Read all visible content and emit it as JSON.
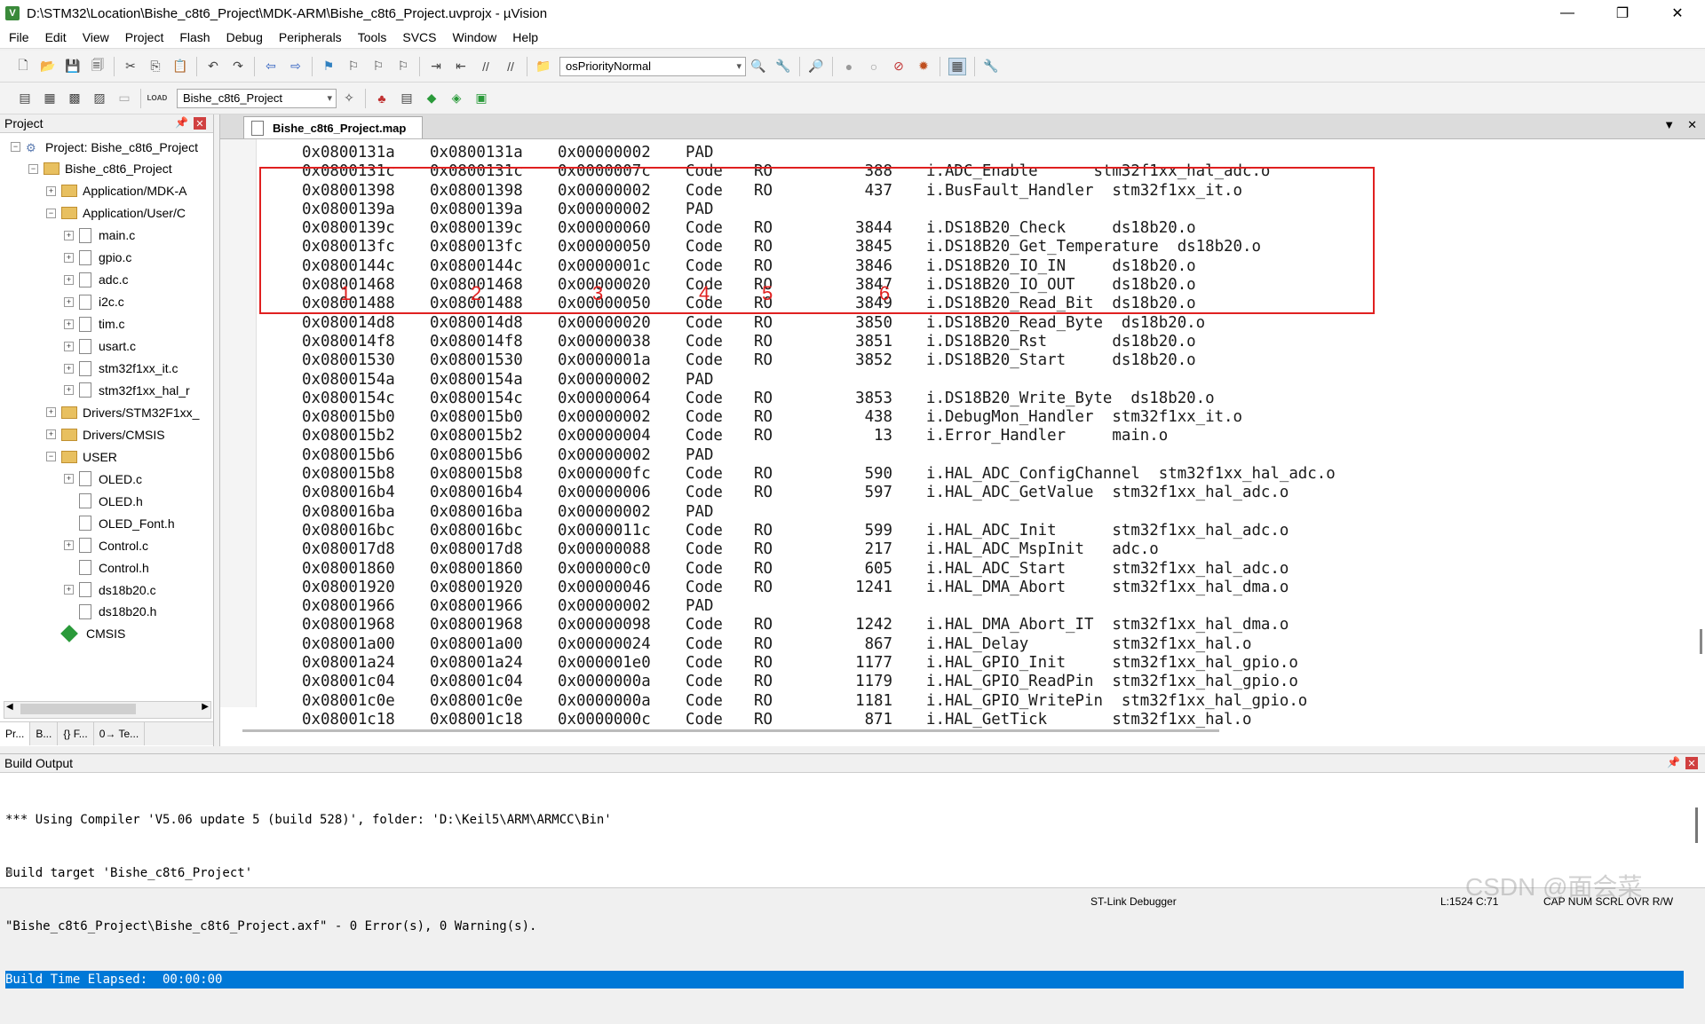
{
  "window": {
    "title": "D:\\STM32\\Location\\Bishe_c8t6_Project\\MDK-ARM\\Bishe_c8t6_Project.uvprojx - µVision",
    "icon_label": "V",
    "controls": [
      "—",
      "❐",
      "✕"
    ]
  },
  "menu": [
    "File",
    "Edit",
    "View",
    "Project",
    "Flash",
    "Debug",
    "Peripherals",
    "Tools",
    "SVCS",
    "Window",
    "Help"
  ],
  "toolbar": {
    "priority_combo": "osPriorityNormal",
    "target_combo": "Bishe_c8t6_Project",
    "load_label": "LOAD"
  },
  "project_panel": {
    "title": "Project",
    "tree": [
      {
        "label": "Project: Bishe_c8t6_Project",
        "level": 0,
        "kind": "project",
        "exp": "−"
      },
      {
        "label": "Bishe_c8t6_Project",
        "level": 1,
        "kind": "target",
        "exp": "−"
      },
      {
        "label": "Application/MDK-A",
        "level": 2,
        "kind": "folder",
        "exp": "+"
      },
      {
        "label": "Application/User/C",
        "level": 2,
        "kind": "folder",
        "exp": "−"
      },
      {
        "label": "main.c",
        "level": 3,
        "kind": "file",
        "exp": "+"
      },
      {
        "label": "gpio.c",
        "level": 3,
        "kind": "file",
        "exp": "+"
      },
      {
        "label": "adc.c",
        "level": 3,
        "kind": "file",
        "exp": "+"
      },
      {
        "label": "i2c.c",
        "level": 3,
        "kind": "file",
        "exp": "+"
      },
      {
        "label": "tim.c",
        "level": 3,
        "kind": "file",
        "exp": "+"
      },
      {
        "label": "usart.c",
        "level": 3,
        "kind": "file",
        "exp": "+"
      },
      {
        "label": "stm32f1xx_it.c",
        "level": 3,
        "kind": "file",
        "exp": "+"
      },
      {
        "label": "stm32f1xx_hal_r",
        "level": 3,
        "kind": "file",
        "exp": "+"
      },
      {
        "label": "Drivers/STM32F1xx_",
        "level": 2,
        "kind": "folder",
        "exp": "+"
      },
      {
        "label": "Drivers/CMSIS",
        "level": 2,
        "kind": "folder",
        "exp": "+"
      },
      {
        "label": "USER",
        "level": 2,
        "kind": "folder",
        "exp": "−"
      },
      {
        "label": "OLED.c",
        "level": 3,
        "kind": "file",
        "exp": "+"
      },
      {
        "label": "OLED.h",
        "level": 3,
        "kind": "file",
        "exp": ""
      },
      {
        "label": "OLED_Font.h",
        "level": 3,
        "kind": "file",
        "exp": ""
      },
      {
        "label": "Control.c",
        "level": 3,
        "kind": "file",
        "exp": "+"
      },
      {
        "label": "Control.h",
        "level": 3,
        "kind": "file",
        "exp": ""
      },
      {
        "label": "ds18b20.c",
        "level": 3,
        "kind": "file",
        "exp": "+"
      },
      {
        "label": "ds18b20.h",
        "level": 3,
        "kind": "file",
        "exp": ""
      },
      {
        "label": "CMSIS",
        "level": 2,
        "kind": "cmsis",
        "exp": ""
      }
    ],
    "tabs": [
      "Pr...",
      "B...",
      "{} F...",
      "0→ Te..."
    ]
  },
  "editor": {
    "tab_label": "Bishe_c8t6_Project.map",
    "rows": [
      [
        "0x0800131a",
        "0x0800131a",
        "0x00000002",
        "PAD",
        "",
        "",
        ""
      ],
      [
        "0x0800131c",
        "0x0800131c",
        "0x0000007c",
        "Code",
        "RO",
        "388",
        "i.ADC_Enable      stm32f1xx_hal_adc.o"
      ],
      [
        "0x08001398",
        "0x08001398",
        "0x00000002",
        "Code",
        "RO",
        "437",
        "i.BusFault_Handler  stm32f1xx_it.o"
      ],
      [
        "0x0800139a",
        "0x0800139a",
        "0x00000002",
        "PAD",
        "",
        "",
        ""
      ],
      [
        "0x0800139c",
        "0x0800139c",
        "0x00000060",
        "Code",
        "RO",
        "3844",
        "i.DS18B20_Check     ds18b20.o"
      ],
      [
        "0x080013fc",
        "0x080013fc",
        "0x00000050",
        "Code",
        "RO",
        "3845",
        "i.DS18B20_Get_Temperature  ds18b20.o"
      ],
      [
        "0x0800144c",
        "0x0800144c",
        "0x0000001c",
        "Code",
        "RO",
        "3846",
        "i.DS18B20_IO_IN     ds18b20.o"
      ],
      [
        "0x08001468",
        "0x08001468",
        "0x00000020",
        "Code",
        "RO",
        "3847",
        "i.DS18B20_IO_OUT    ds18b20.o"
      ],
      [
        "0x08001488",
        "0x08001488",
        "0x00000050",
        "Code",
        "RO",
        "3849",
        "i.DS18B20_Read_Bit  ds18b20.o"
      ],
      [
        "0x080014d8",
        "0x080014d8",
        "0x00000020",
        "Code",
        "RO",
        "3850",
        "i.DS18B20_Read_Byte  ds18b20.o"
      ],
      [
        "0x080014f8",
        "0x080014f8",
        "0x00000038",
        "Code",
        "RO",
        "3851",
        "i.DS18B20_Rst       ds18b20.o"
      ],
      [
        "0x08001530",
        "0x08001530",
        "0x0000001a",
        "Code",
        "RO",
        "3852",
        "i.DS18B20_Start     ds18b20.o"
      ],
      [
        "0x0800154a",
        "0x0800154a",
        "0x00000002",
        "PAD",
        "",
        "",
        ""
      ],
      [
        "0x0800154c",
        "0x0800154c",
        "0x00000064",
        "Code",
        "RO",
        "3853",
        "i.DS18B20_Write_Byte  ds18b20.o"
      ],
      [
        "0x080015b0",
        "0x080015b0",
        "0x00000002",
        "Code",
        "RO",
        "438",
        "i.DebugMon_Handler  stm32f1xx_it.o"
      ],
      [
        "0x080015b2",
        "0x080015b2",
        "0x00000004",
        "Code",
        "RO",
        "13",
        "i.Error_Handler     main.o"
      ],
      [
        "0x080015b6",
        "0x080015b6",
        "0x00000002",
        "PAD",
        "",
        "",
        ""
      ],
      [
        "0x080015b8",
        "0x080015b8",
        "0x000000fc",
        "Code",
        "RO",
        "590",
        "i.HAL_ADC_ConfigChannel  stm32f1xx_hal_adc.o"
      ],
      [
        "0x080016b4",
        "0x080016b4",
        "0x00000006",
        "Code",
        "RO",
        "597",
        "i.HAL_ADC_GetValue  stm32f1xx_hal_adc.o"
      ],
      [
        "0x080016ba",
        "0x080016ba",
        "0x00000002",
        "PAD",
        "",
        "",
        ""
      ],
      [
        "0x080016bc",
        "0x080016bc",
        "0x0000011c",
        "Code",
        "RO",
        "599",
        "i.HAL_ADC_Init      stm32f1xx_hal_adc.o"
      ],
      [
        "0x080017d8",
        "0x080017d8",
        "0x00000088",
        "Code",
        "RO",
        "217",
        "i.HAL_ADC_MspInit   adc.o"
      ],
      [
        "0x08001860",
        "0x08001860",
        "0x000000c0",
        "Code",
        "RO",
        "605",
        "i.HAL_ADC_Start     stm32f1xx_hal_adc.o"
      ],
      [
        "0x08001920",
        "0x08001920",
        "0x00000046",
        "Code",
        "RO",
        "1241",
        "i.HAL_DMA_Abort     stm32f1xx_hal_dma.o"
      ],
      [
        "0x08001966",
        "0x08001966",
        "0x00000002",
        "PAD",
        "",
        "",
        ""
      ],
      [
        "0x08001968",
        "0x08001968",
        "0x00000098",
        "Code",
        "RO",
        "1242",
        "i.HAL_DMA_Abort_IT  stm32f1xx_hal_dma.o"
      ],
      [
        "0x08001a00",
        "0x08001a00",
        "0x00000024",
        "Code",
        "RO",
        "867",
        "i.HAL_Delay         stm32f1xx_hal.o"
      ],
      [
        "0x08001a24",
        "0x08001a24",
        "0x000001e0",
        "Code",
        "RO",
        "1177",
        "i.HAL_GPIO_Init     stm32f1xx_hal_gpio.o"
      ],
      [
        "0x08001c04",
        "0x08001c04",
        "0x0000000a",
        "Code",
        "RO",
        "1179",
        "i.HAL_GPIO_ReadPin  stm32f1xx_hal_gpio.o"
      ],
      [
        "0x08001c0e",
        "0x08001c0e",
        "0x0000000a",
        "Code",
        "RO",
        "1181",
        "i.HAL_GPIO_WritePin  stm32f1xx_hal_gpio.o"
      ],
      [
        "0x08001c18",
        "0x08001c18",
        "0x0000000c",
        "Code",
        "RO",
        "871",
        "i.HAL_GetTick       stm32f1xx_hal.o"
      ]
    ],
    "annotation_numbers": [
      "1",
      "2",
      "3",
      "4",
      "5",
      "6"
    ],
    "annotation_color": "#e02020"
  },
  "build_output": {
    "title": "Build Output",
    "lines": [
      "*** Using Compiler 'V5.06 update 5 (build 528)', folder: 'D:\\Keil5\\ARM\\ARMCC\\Bin'",
      "Build target 'Bishe_c8t6_Project'",
      "\"Bishe_c8t6_Project\\Bishe_c8t6_Project.axf\" - 0 Error(s), 0 Warning(s).",
      "Build Time Elapsed:  00:00:00"
    ],
    "selected_color": "#0078d7"
  },
  "status": {
    "debugger": "ST-Link Debugger",
    "position": "L:1524 C:71",
    "indicators": "CAP  NUM  SCRL  OVR  R/W"
  },
  "watermark": "CSDN @面会菜"
}
